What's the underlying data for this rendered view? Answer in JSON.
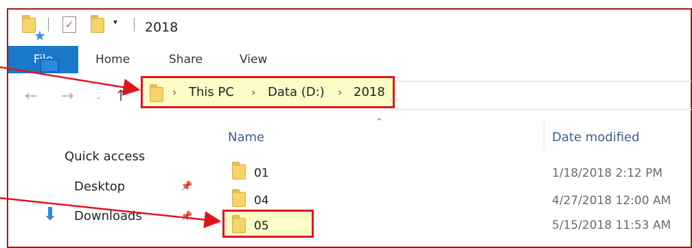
{
  "window": {
    "title": "2018"
  },
  "quick_access_toolbar": [
    "folder-icon",
    "properties-icon",
    "new-folder-icon",
    "customize-dropdown"
  ],
  "ribbon": {
    "tabs": [
      "File",
      "Home",
      "Share",
      "View"
    ],
    "active_tab": "File"
  },
  "address_bar": {
    "breadcrumbs": [
      "This PC",
      "Data (D:)",
      "2018"
    ]
  },
  "navigation_pane": {
    "items": [
      {
        "label": "Quick access",
        "icon": "star-icon"
      },
      {
        "label": "Desktop",
        "icon": "desktop-icon",
        "pinned": true
      },
      {
        "label": "Downloads",
        "icon": "downloads-icon",
        "pinned": true
      }
    ]
  },
  "file_list": {
    "columns": [
      "Name",
      "Date modified"
    ],
    "rows": [
      {
        "name": "01",
        "date_modified": "1/18/2018 2:12 PM"
      },
      {
        "name": "04",
        "date_modified": "4/27/2018 12:00 AM"
      },
      {
        "name": "05",
        "date_modified": "5/15/2018 11:53 AM",
        "highlighted": true
      }
    ]
  },
  "colors": {
    "annotation_red": "#e1141c",
    "highlight_fill": "#fbfcc6",
    "file_tab_blue": "#1979ca",
    "folder_yellow": "#f6d36b"
  }
}
